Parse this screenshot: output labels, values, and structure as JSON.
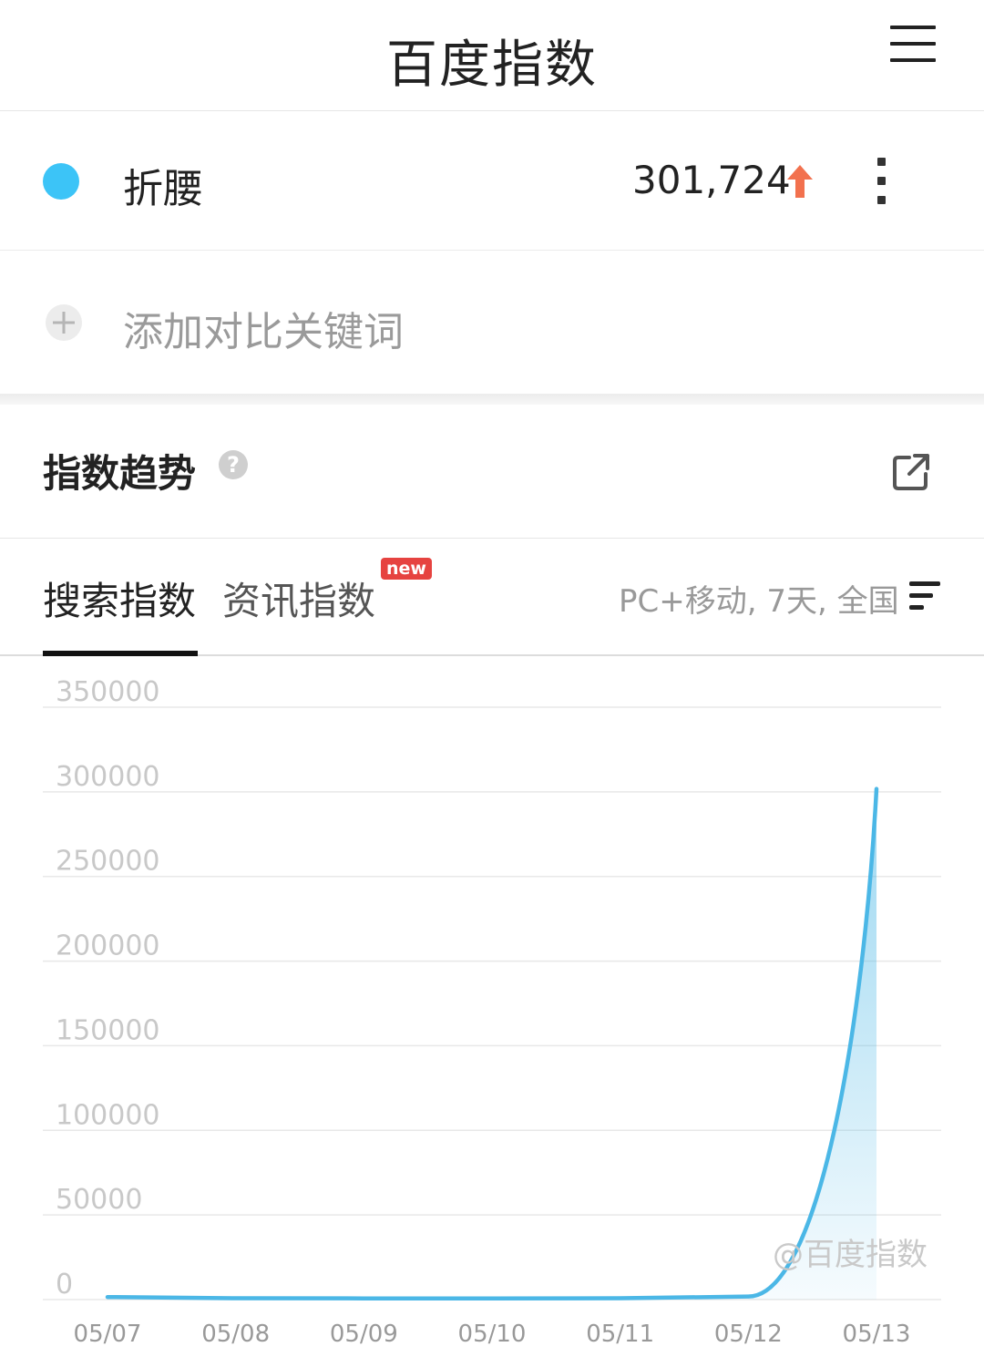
{
  "header": {
    "title": "百度指数"
  },
  "keyword": {
    "name": "折腰",
    "value": "301,724",
    "dot_color": "#3cc4f7",
    "trend_color": "#f2714e"
  },
  "add_keyword": {
    "label": "添加对比关键词"
  },
  "section": {
    "title": "指数趋势"
  },
  "tabs": [
    {
      "label": "搜索指数",
      "active": true
    },
    {
      "label": "资讯指数",
      "active": false,
      "badge": "new"
    }
  ],
  "filter": {
    "label": "PC+移动, 7天, 全国"
  },
  "watermark": "@百度指数",
  "chart_data": {
    "type": "area",
    "x": [
      "05/07",
      "05/08",
      "05/09",
      "05/10",
      "05/11",
      "05/12",
      "05/13"
    ],
    "series": [
      {
        "values": [
          1500,
          800,
          700,
          700,
          800,
          1800,
          301724
        ]
      }
    ],
    "y_ticks": [
      "350000",
      "300000",
      "250000",
      "200000",
      "150000",
      "100000",
      "50000",
      "0"
    ],
    "ylim": [
      0,
      350000
    ],
    "grid": true,
    "line_color": "#4bb7e6"
  }
}
